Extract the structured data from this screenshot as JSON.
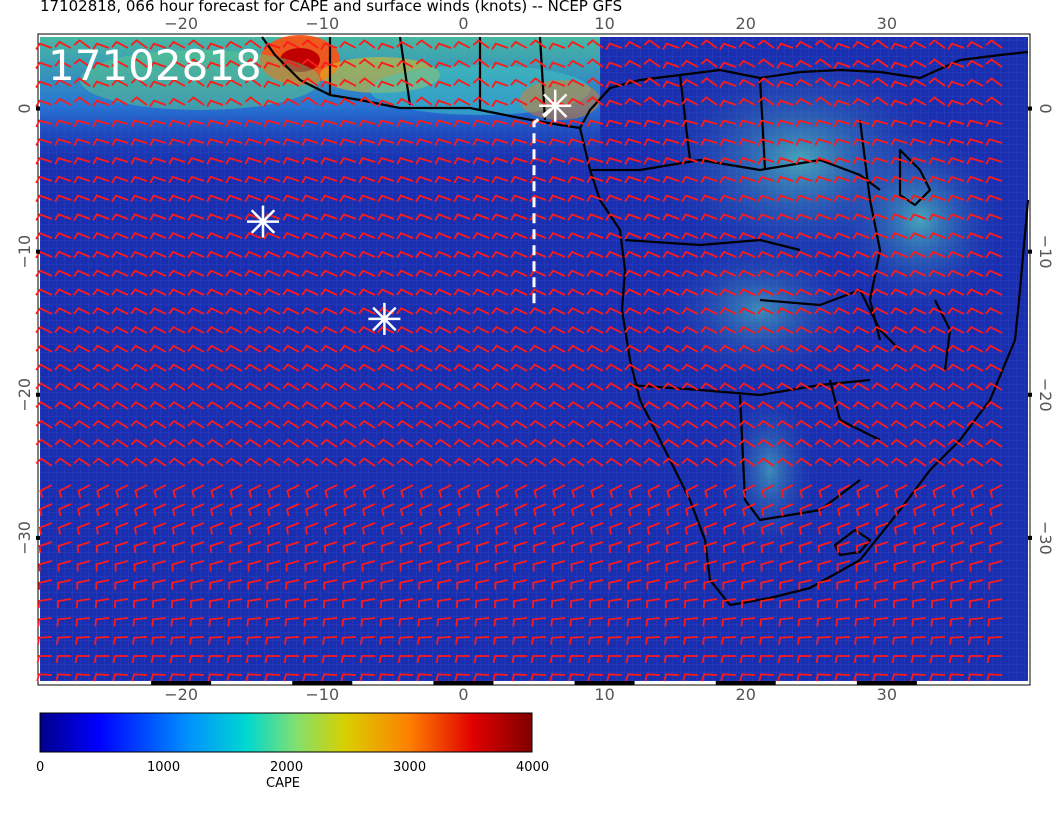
{
  "title": "17102818, 066 hour forecast for CAPE and surface winds (knots) -- NCEP GFS",
  "date_label": "17102818",
  "map": {
    "lon_range": [
      -30,
      40
    ],
    "lat_range": [
      -40,
      5
    ],
    "top_lon_ticks": [
      "−20",
      "−10",
      "0",
      "10",
      "20",
      "30"
    ],
    "bottom_lon_ticks": [
      "−20",
      "−10",
      "0",
      "10",
      "20",
      "30"
    ],
    "left_lat_ticks": [
      "0",
      "−10",
      "−20",
      "−30"
    ],
    "right_lat_ticks": [
      "0",
      "−10",
      "−20",
      "−30"
    ],
    "ocean_color": "#1a2fb0",
    "barb_color": "#ff1a1a",
    "coast_color": "#000000",
    "marker_color": "#ffffff",
    "markers": [
      {
        "lon": 6.5,
        "lat": 0.2,
        "name": "star"
      },
      {
        "lon": -14.2,
        "lat": -7.9,
        "name": "star"
      },
      {
        "lon": -5.6,
        "lat": -14.7,
        "name": "star"
      }
    ],
    "dashed_track": [
      [
        5.0,
        -13.6
      ],
      [
        5.0,
        -1.0
      ],
      [
        6.5,
        0.2
      ]
    ]
  },
  "colorbar": {
    "label": "CAPE",
    "ticks": [
      "0",
      "1000",
      "2000",
      "3000",
      "4000"
    ],
    "colors": [
      "#00008b",
      "#0000ff",
      "#0090ff",
      "#00d8d0",
      "#80e070",
      "#d8d000",
      "#ff8000",
      "#e00000",
      "#800000"
    ]
  }
}
